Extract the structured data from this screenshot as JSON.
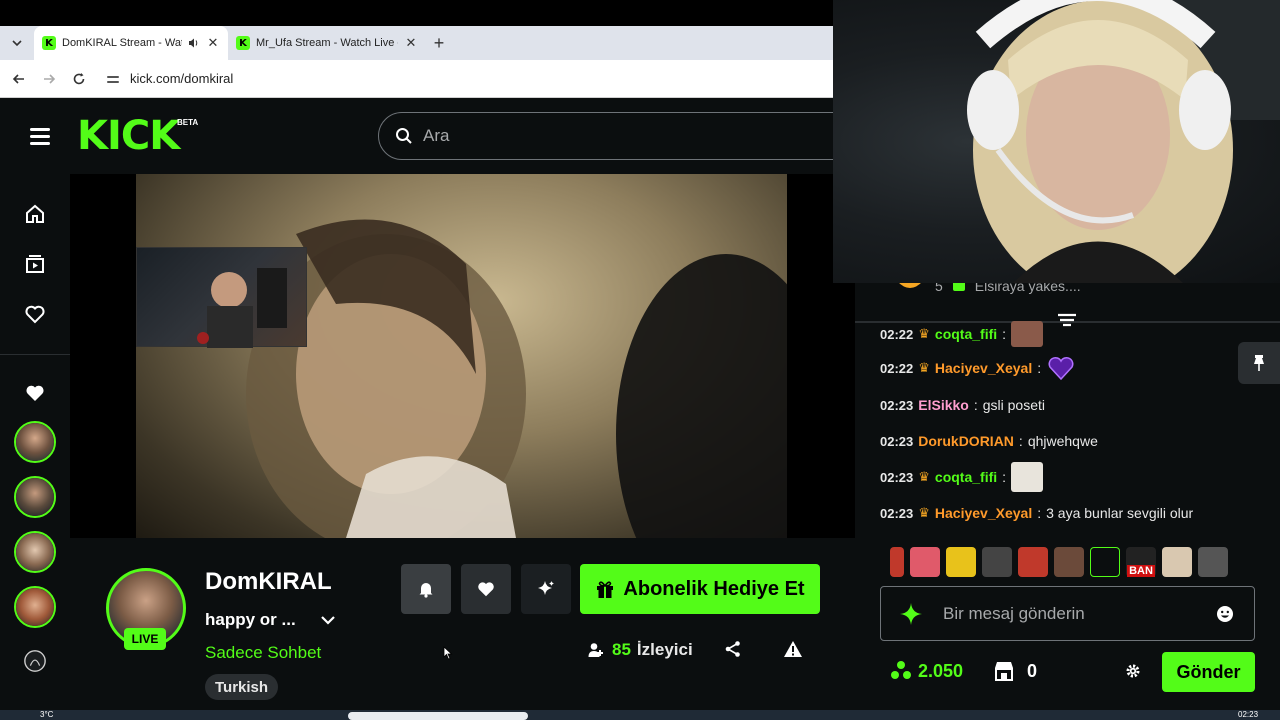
{
  "browser": {
    "tabs": [
      {
        "title": "DomKIRAL Stream - Watch",
        "active": true,
        "audio": true
      },
      {
        "title": "Mr_Ufa Stream - Watch Live on",
        "active": false,
        "audio": false
      }
    ],
    "new_tab": "+",
    "url": "kick.com/domkiral"
  },
  "header": {
    "logo": "KICK",
    "beta": "BETA",
    "search_placeholder": "Ara"
  },
  "channel": {
    "name": "DomKIRAL",
    "title": "happy or ...",
    "category": "Sadece Sohbet",
    "tag": "Turkish",
    "live_badge": "LIVE",
    "gift_button": "Abonelik Hediye Et",
    "viewer_count": "85",
    "viewer_label": "İzleyici"
  },
  "chat": {
    "pinned_fragment_count": "5",
    "pinned_fragment_text": "Elsiraya yakes....",
    "messages": [
      {
        "time": "02:22",
        "crown": true,
        "user": "coqta_fifi",
        "color": "#53fc18",
        "text": "",
        "emote": "#8a5a4a"
      },
      {
        "time": "02:22",
        "crown": true,
        "user": "Haciyev_Xeyal",
        "color": "#ff9a2b",
        "text": "",
        "emote": "#7a2fd0"
      },
      {
        "time": "02:23",
        "crown": false,
        "user": "ElSikko",
        "color": "#ff9ecf",
        "text": "gsli poseti",
        "emote": ""
      },
      {
        "time": "02:23",
        "crown": false,
        "user": "DorukDORIAN",
        "color": "#ff9a2b",
        "text": "qhjwehqwe",
        "emote": ""
      },
      {
        "time": "02:23",
        "crown": true,
        "user": "coqta_fifi",
        "color": "#53fc18",
        "text": "",
        "emote": "#e8e4dc"
      },
      {
        "time": "02:23",
        "crown": true,
        "user": "Haciyev_Xeyal",
        "color": "#ff9a2b",
        "text": "3 aya bunlar sevgili olur",
        "emote": ""
      }
    ],
    "emote_bar": [
      "#c0392b",
      "#e05a6a",
      "#e8c21b",
      "#444444",
      "#c0392b",
      "#6b4a3a",
      "#53fc18",
      "#222222",
      "#d9c8b0",
      "#555555"
    ],
    "emote_ban_label": "BAN",
    "input_placeholder": "Bir mesaj gönderin",
    "points": "2.050",
    "store_count": "0",
    "send_button": "Gönder"
  },
  "taskbar": {
    "temp": "3°C",
    "clock": "02:23"
  },
  "colors": {
    "accent": "#53fc18",
    "background": "#0b0e0f",
    "surface": "#2a2e31"
  }
}
